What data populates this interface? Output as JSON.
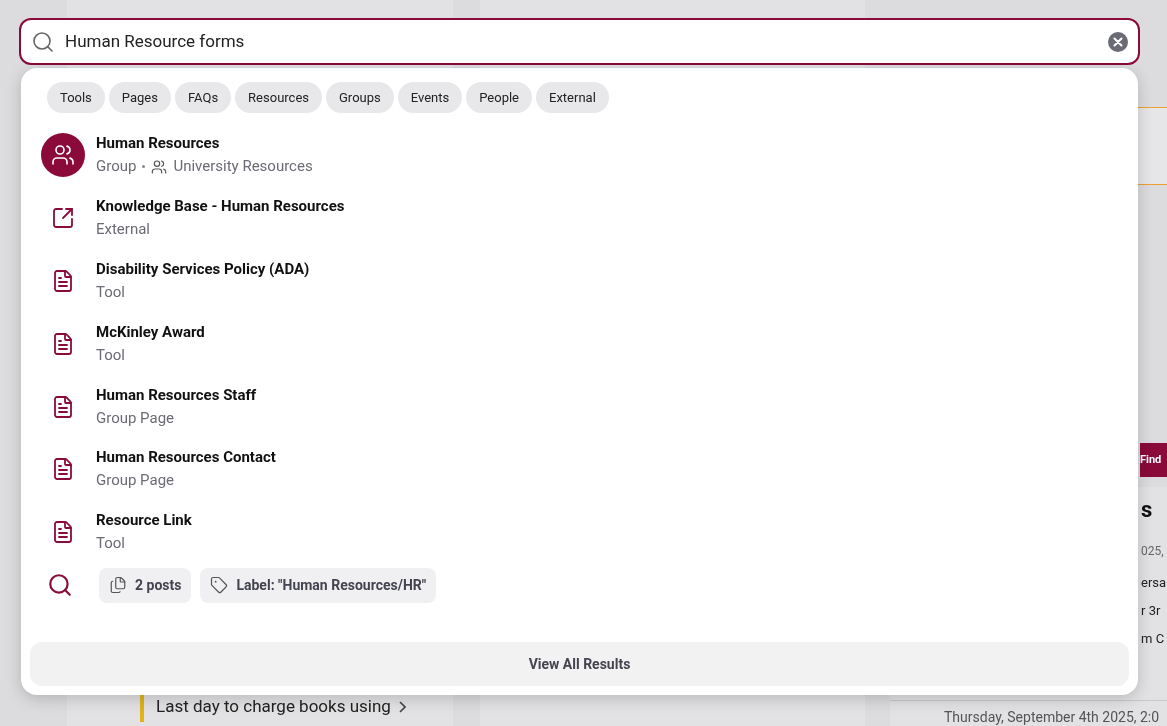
{
  "search": {
    "value": "Human Resource forms"
  },
  "filters": [
    {
      "label": "Tools"
    },
    {
      "label": "Pages"
    },
    {
      "label": "FAQs"
    },
    {
      "label": "Resources"
    },
    {
      "label": "Groups"
    },
    {
      "label": "Events"
    },
    {
      "label": "People"
    },
    {
      "label": "External"
    }
  ],
  "results": [
    {
      "kind": "group",
      "title": "Human Resources",
      "subtitle": "Group",
      "meta": "University Resources"
    },
    {
      "kind": "external",
      "title": "Knowledge Base - Human Resources",
      "subtitle": "External"
    },
    {
      "kind": "document",
      "title": "Disability Services Policy (ADA)",
      "subtitle": "Tool"
    },
    {
      "kind": "document",
      "title": "McKinley Award",
      "subtitle": "Tool"
    },
    {
      "kind": "document",
      "title": "Human Resources Staff",
      "subtitle": "Group Page"
    },
    {
      "kind": "document",
      "title": "Human Resources Contact",
      "subtitle": "Group Page"
    },
    {
      "kind": "document",
      "title": "Resource Link",
      "subtitle": "Tool"
    }
  ],
  "post_search": {
    "posts": "2 posts",
    "label": "Label: \"Human Resources/HR\""
  },
  "view_all": "View All Results",
  "background": {
    "left_item": "Last day to charge books using",
    "find_button": "Find",
    "heading": "s",
    "date": "025,",
    "body_lines": [
      "ersa",
      "r 3r",
      "m C"
    ],
    "event_date": "Thursday, September 4th 2025, 2:0"
  }
}
